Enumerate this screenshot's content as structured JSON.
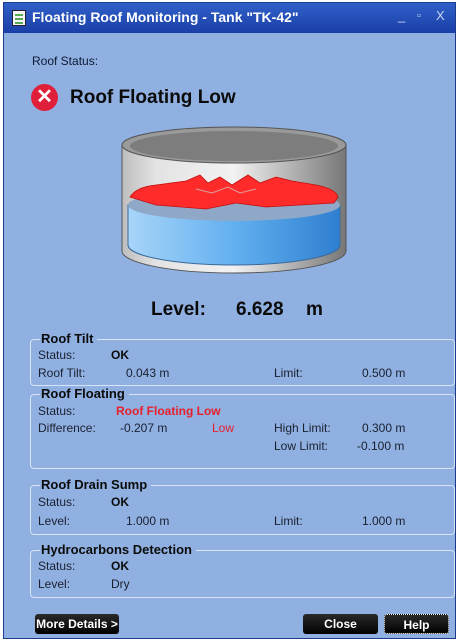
{
  "window": {
    "title": "Floating Roof Monitoring - Tank \"TK-42\"",
    "controls": {
      "minimize": "_",
      "maximize": "▫",
      "close": "X"
    }
  },
  "roof_status": {
    "label": "Roof Status:",
    "value": "Roof Floating Low",
    "icon": "error-x-icon"
  },
  "level": {
    "label": "Level:",
    "value": "6.628",
    "unit": "m"
  },
  "roof_tilt": {
    "title": "Roof Tilt",
    "status_label": "Status:",
    "status_value": "OK",
    "tilt_label": "Roof Tilt:",
    "tilt_value": "0.043 m",
    "limit_label": "Limit:",
    "limit_value": "0.500 m"
  },
  "roof_floating": {
    "title": "Roof Floating",
    "status_label": "Status:",
    "status_value": "Roof Floating Low",
    "diff_label": "Difference:",
    "diff_value": "-0.207 m",
    "diff_flag": "Low",
    "high_limit_label": "High Limit:",
    "high_limit_value": "0.300 m",
    "low_limit_label": "Low Limit:",
    "low_limit_value": "-0.100 m"
  },
  "roof_drain_sump": {
    "title": "Roof Drain Sump",
    "status_label": "Status:",
    "status_value": "OK",
    "level_label": "Level:",
    "level_value": "1.000 m",
    "limit_label": "Limit:",
    "limit_value": "1.000 m"
  },
  "hydrocarbons": {
    "title": "Hydrocarbons Detection",
    "status_label": "Status:",
    "status_value": "OK",
    "level_label": "Level:",
    "level_value": "Dry"
  },
  "buttons": {
    "more_details": "More Details >",
    "close": "Close",
    "help": "Help"
  },
  "colors": {
    "alarm": "#e8202c",
    "roof": "#ff2a2a",
    "liquid": "#4fa3e6",
    "panel": "#8fb0e0",
    "titlebar": "#1a3fa8"
  }
}
